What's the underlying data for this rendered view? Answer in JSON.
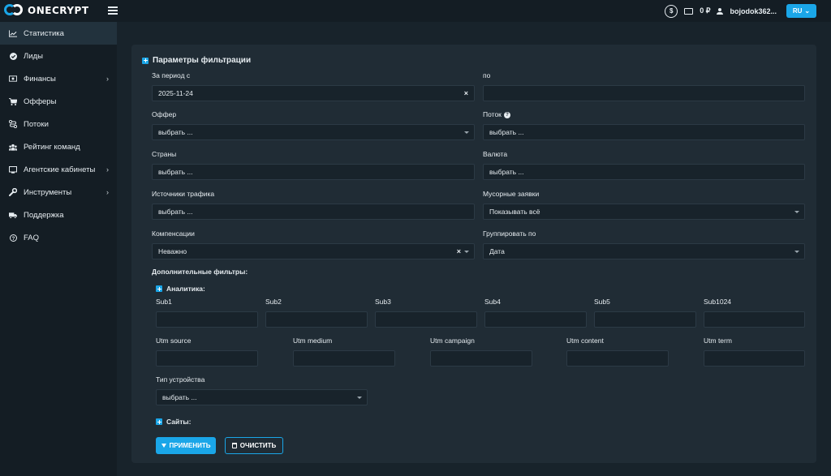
{
  "brand": {
    "name": "ONECRYPT",
    "accent": "#1aa6e8"
  },
  "topbar": {
    "balance": "0 ₽",
    "username": "bojodok362...",
    "lang": "RU"
  },
  "sidebar": {
    "items": [
      {
        "label": "Статистика",
        "icon": "chart-line-icon",
        "active": true,
        "has_chevron": false
      },
      {
        "label": "Лиды",
        "icon": "check-circle-icon",
        "has_chevron": false
      },
      {
        "label": "Финансы",
        "icon": "money-icon",
        "has_chevron": true
      },
      {
        "label": "Офферы",
        "icon": "cart-icon",
        "has_chevron": false
      },
      {
        "label": "Потоки",
        "icon": "route-icon",
        "has_chevron": false
      },
      {
        "label": "Рейтинг команд",
        "icon": "users-icon",
        "has_chevron": false
      },
      {
        "label": "Агентские кабинеты",
        "icon": "cabinet-icon",
        "has_chevron": true
      },
      {
        "label": "Инструменты",
        "icon": "wrench-icon",
        "has_chevron": true
      },
      {
        "label": "Поддержка",
        "icon": "truck-icon",
        "has_chevron": false
      },
      {
        "label": "FAQ",
        "icon": "question-icon",
        "has_chevron": false
      }
    ]
  },
  "filters": {
    "title": "Параметры фильтрации",
    "period_from_label": "За период с",
    "period_from_value": "2025-11-24",
    "period_to_label": "по",
    "period_to_value": "",
    "offer_label": "Оффер",
    "offer_value": "выбрать ...",
    "stream_label": "Поток",
    "stream_value": "выбрать ...",
    "countries_label": "Страны",
    "countries_value": "выбрать ...",
    "currency_label": "Валюта",
    "currency_value": "выбрать ...",
    "sources_label": "Источники трафика",
    "sources_value": "выбрать ...",
    "trash_label": "Мусорные заявки",
    "trash_value": "Показывать всё",
    "comp_label": "Компенсации",
    "comp_value": "Неважно",
    "group_label": "Группировать по",
    "group_value": "Дата",
    "extra_label": "Дополнительные фильтры:",
    "analytics_label": "Аналитика:",
    "subs": [
      "Sub1",
      "Sub2",
      "Sub3",
      "Sub4",
      "Sub5",
      "Sub1024"
    ],
    "utms": [
      "Utm source",
      "Utm medium",
      "Utm campaign",
      "Utm content",
      "Utm term"
    ],
    "device_label": "Тип устройства",
    "device_value": "выбрать ...",
    "sites_label": "Сайты:",
    "apply_label": "ПРИМЕНИТЬ",
    "clear_label": "ОЧИСТИТЬ"
  }
}
